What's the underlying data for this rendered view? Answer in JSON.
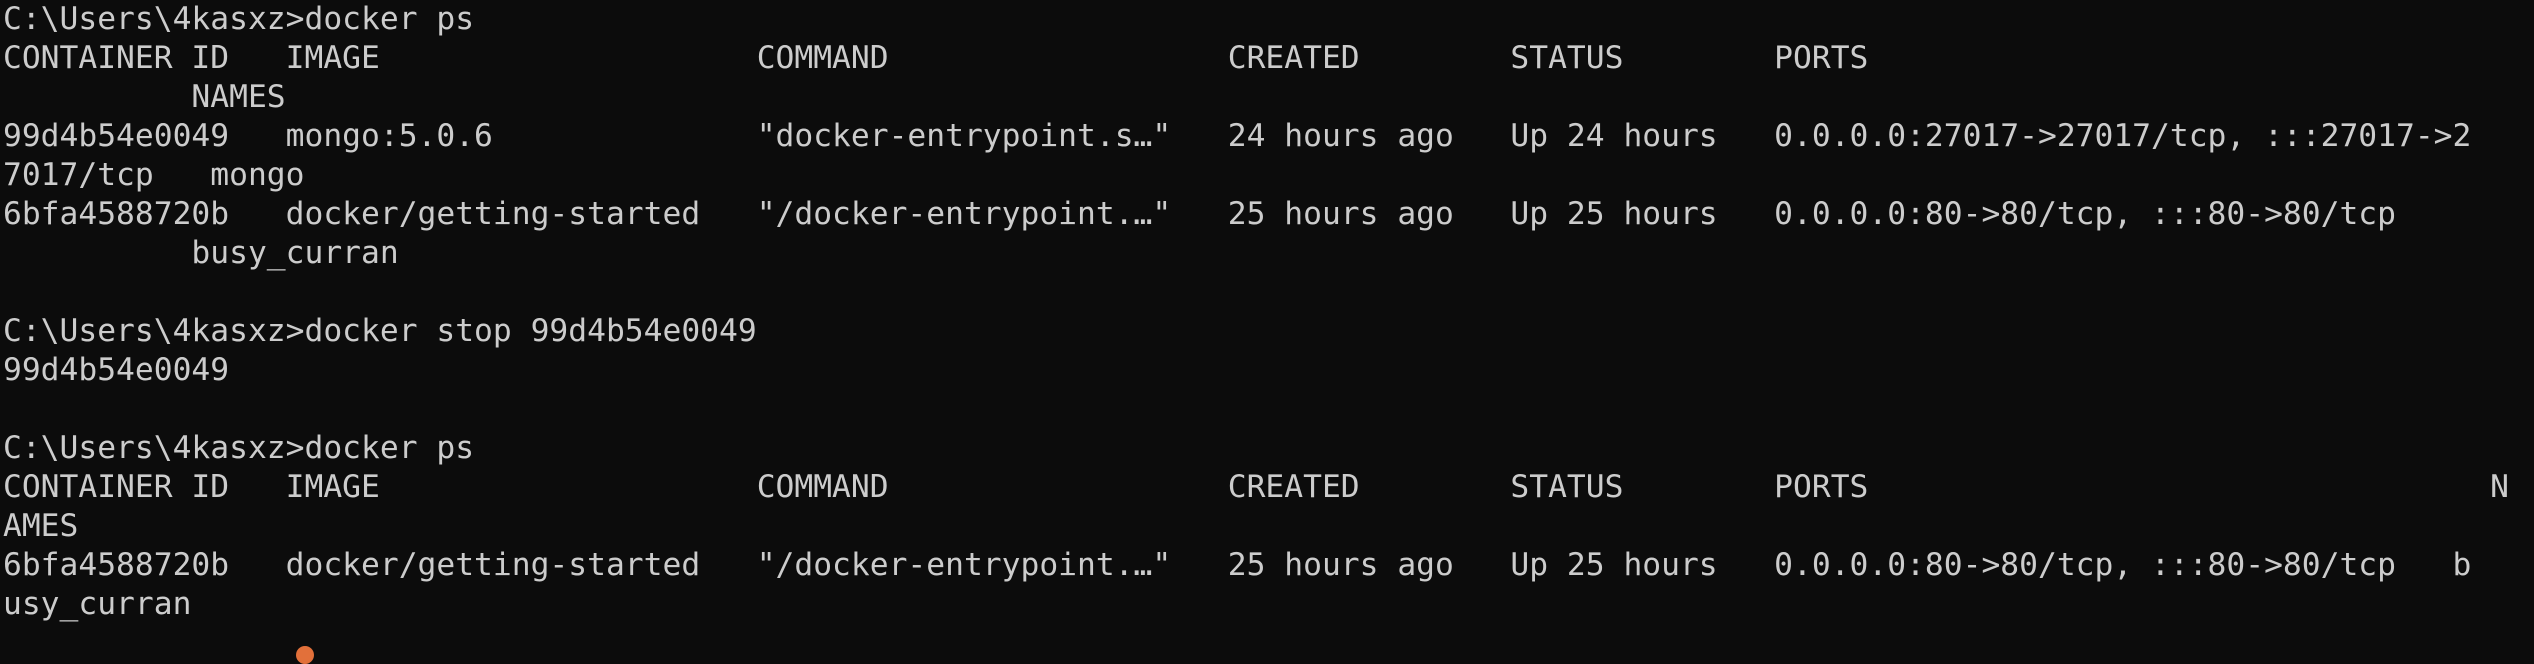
{
  "terminal": {
    "blocks": [
      {
        "prompt": "C:\\Users\\4kasxz>docker ps",
        "output": [
          "CONTAINER ID   IMAGE                    COMMAND                  CREATED        STATUS        PORTS",
          "          NAMES",
          "99d4b54e0049   mongo:5.0.6              \"docker-entrypoint.s…\"   24 hours ago   Up 24 hours   0.0.0.0:27017->27017/tcp, :::27017->2",
          "7017/tcp   mongo",
          "6bfa4588720b   docker/getting-started   \"/docker-entrypoint.…\"   25 hours ago   Up 25 hours   0.0.0.0:80->80/tcp, :::80->80/tcp",
          "          busy_curran"
        ]
      },
      {
        "prompt": "C:\\Users\\4kasxz>docker stop 99d4b54e0049",
        "output": [
          "99d4b54e0049"
        ]
      },
      {
        "prompt": "C:\\Users\\4kasxz>docker ps",
        "output": [
          "CONTAINER ID   IMAGE                    COMMAND                  CREATED        STATUS        PORTS                                 N",
          "AMES",
          "6bfa4588720b   docker/getting-started   \"/docker-entrypoint.…\"   25 hours ago   Up 25 hours   0.0.0.0:80->80/tcp, :::80->80/tcp   b",
          "usy_curran"
        ]
      }
    ]
  }
}
